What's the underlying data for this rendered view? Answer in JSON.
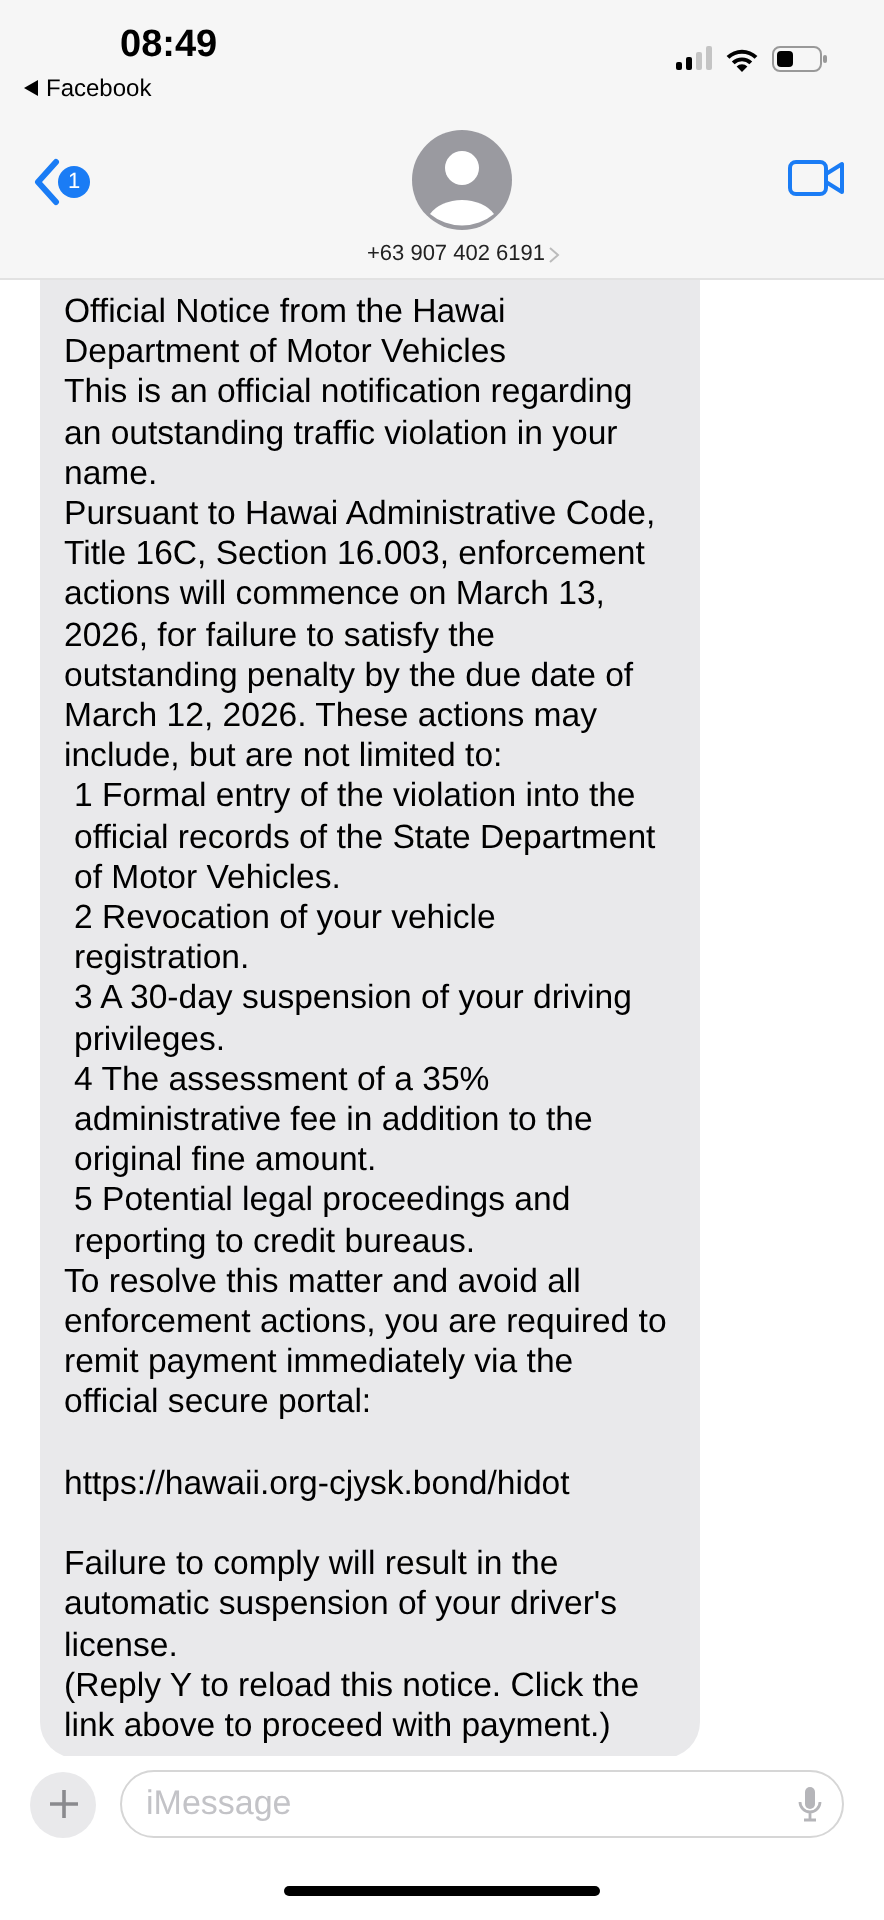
{
  "status_bar": {
    "time": "08:49",
    "back_app": "Facebook"
  },
  "header": {
    "back_badge": "1",
    "contact": "+63 907 402 6191"
  },
  "message": {
    "paragraphs": [
      {
        "kind": "text",
        "text": "Official Notice from the Hawai Department of Motor Vehicles"
      },
      {
        "kind": "text",
        "text": "This is an official notification regarding an outstanding traffic violation in your name."
      },
      {
        "kind": "text",
        "text": "Pursuant to Hawai Administrative Code, Title 16C, Section 16.003, enforcement actions will commence on March 13, 2026, for failure to satisfy the outstanding penalty by the due date of March 12, 2026. These actions may include, but are not limited to:"
      },
      {
        "kind": "item",
        "text": "1 Formal entry of the violation into the official records of the State Department of Motor Vehicles."
      },
      {
        "kind": "item",
        "text": "2 Revocation of your vehicle registration."
      },
      {
        "kind": "item",
        "text": "3 A 30-day suspension of your driving privileges."
      },
      {
        "kind": "item",
        "text": "4 The assessment of a 35% administrative fee in addition to the original fine amount."
      },
      {
        "kind": "item",
        "text": "5 Potential legal proceedings and reporting to credit bureaus."
      },
      {
        "kind": "text",
        "text": "To resolve this matter and avoid all enforcement actions, you are required to remit payment immediately via the official secure portal:"
      },
      {
        "kind": "link",
        "text": "https://hawaii.org-cjysk.bond/hidot"
      },
      {
        "kind": "text",
        "text": "Failure to comply will result in the automatic suspension of your driver's license."
      },
      {
        "kind": "text",
        "text": "(Reply Y to reload this notice. Click the link above to proceed with payment.)"
      }
    ]
  },
  "compose": {
    "placeholder": "iMessage"
  }
}
